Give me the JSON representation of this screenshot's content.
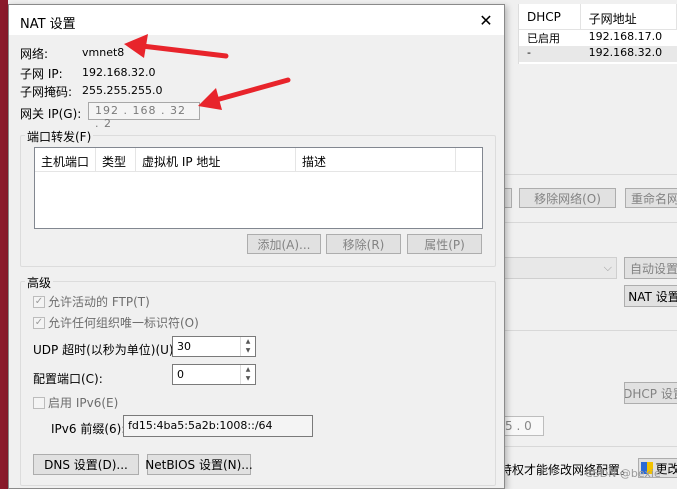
{
  "background_window": {
    "table": {
      "headers": [
        "DHCP",
        "子网地址"
      ],
      "rows": [
        {
          "dhcp": "已启用",
          "subnet": "192.168.17.0"
        },
        {
          "dhcp": "-",
          "subnet": "192.168.32.0"
        }
      ]
    },
    "buttons": {
      "remove_network": "移除网络(O)",
      "rename_network": "重命名网",
      "auto_settings": "自动设置",
      "nat_settings": "NAT 设置",
      "dhcp_settings": "DHCP 设置"
    },
    "ip_fragment": "5 . 0",
    "admin_text": "特权才能修改网络配置。",
    "admin_button": "更改",
    "watermark": "CSDN @bexie"
  },
  "dialog": {
    "title": "NAT 设置",
    "close_glyph": "✕",
    "network_label": "网络:",
    "network_value": "vmnet8",
    "subnet_ip_label": "子网 IP:",
    "subnet_ip_value": "192.168.32.0",
    "subnet_mask_label": "子网掩码:",
    "subnet_mask_value": "255.255.255.0",
    "gateway_label": "网关 IP(G):",
    "gateway_value": "192 . 168 . 32 . 2",
    "port_forwarding": {
      "title": "端口转发(F)",
      "columns": [
        "主机端口",
        "类型",
        "虚拟机 IP 地址",
        "描述"
      ],
      "add_button": "添加(A)...",
      "remove_button": "移除(R)",
      "properties_button": "属性(P)"
    },
    "advanced": {
      "title": "高级",
      "allow_ftp": "允许活动的 FTP(T)",
      "allow_org_id": "允许任何组织唯一标识符(O)",
      "udp_timeout_label": "UDP 超时(以秒为单位)(U):",
      "udp_timeout_value": "30",
      "config_port_label": "配置端口(C):",
      "config_port_value": "0",
      "enable_ipv6": "启用 IPv6(E)",
      "ipv6_prefix_label": "IPv6 前缀(6):",
      "ipv6_prefix_value": "fd15:4ba5:5a2b:1008::/64",
      "dns_button": "DNS 设置(D)...",
      "netbios_button": "NetBIOS 设置(N)..."
    }
  },
  "colors": {
    "annotation_arrow": "#e8242b",
    "desktop_strip": "#8a1a2b"
  }
}
